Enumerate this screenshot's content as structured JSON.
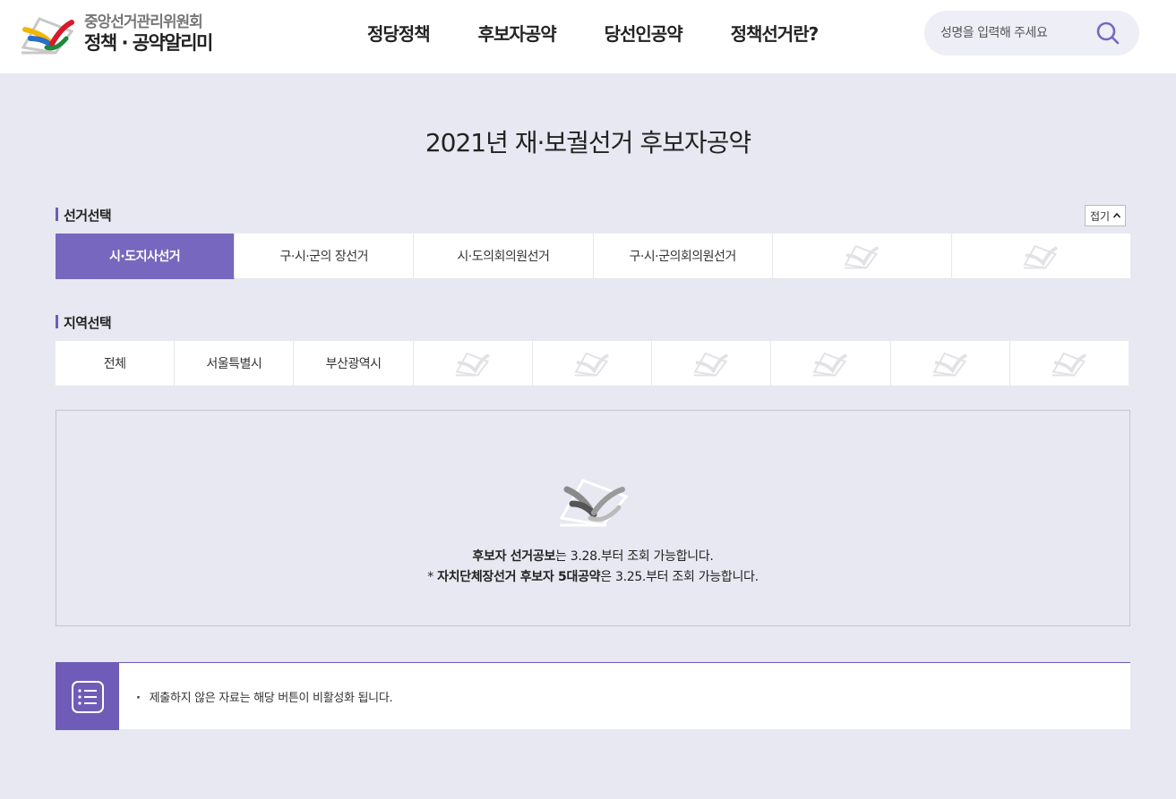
{
  "header": {
    "org_name": "중앙선거관리위원회",
    "service_name": "정책 · 공약알리미",
    "nav": [
      "정당정책",
      "후보자공약",
      "당선인공약",
      "정책선거란?"
    ],
    "search": {
      "placeholder": "성명을 입력해 주세요",
      "value": ""
    }
  },
  "page": {
    "title": "2021년 재·보궐선거 후보자공약"
  },
  "election_select": {
    "label": "선거선택",
    "fold_label": "접기",
    "tabs": [
      "시·도지사선거",
      "구·시·군의 장선거",
      "시·도의회의원선거",
      "구·시·군의회의원선거",
      "",
      ""
    ],
    "active_index": 0
  },
  "region_select": {
    "label": "지역선택",
    "tabs": [
      "전체",
      "서울특별시",
      "부산광역시",
      "",
      "",
      "",
      "",
      "",
      ""
    ]
  },
  "notice": {
    "line1_bold": "후보자 선거공보",
    "line1_rest": "는 3.28.부터 조회 가능합니다.",
    "line2_prefix": "* ",
    "line2_bold": "자치단체장선거 후보자 5대공약",
    "line2_rest": "은 3.25.부터 조회 가능합니다."
  },
  "info": {
    "text": "제출하지 않은 자료는 해당 버튼이 비활성화 됩니다."
  },
  "colors": {
    "accent": "#7767be",
    "background": "#e8e8f2"
  }
}
